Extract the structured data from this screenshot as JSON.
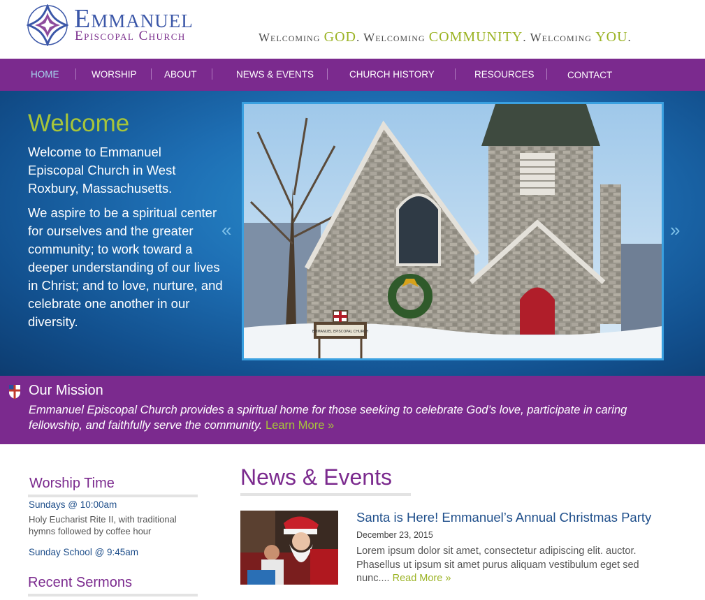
{
  "brand": {
    "name": "Emmanuel",
    "subtitle": "Episcopal Church",
    "tagline": {
      "w1": "Welcoming ",
      "h1": "GOD",
      "p1": ". ",
      "w2": "Welcoming ",
      "h2": "COMMUNITY",
      "p2": ". ",
      "w3": "Welcoming ",
      "h3": "YOU",
      "p3": "."
    }
  },
  "nav": {
    "items": [
      {
        "label": "Home"
      },
      {
        "label": "Worship"
      },
      {
        "label": "About"
      },
      {
        "label": "News & Events"
      },
      {
        "label": "Church History"
      },
      {
        "label": "Resources"
      },
      {
        "label": "Contact"
      }
    ],
    "active": "Home"
  },
  "hero": {
    "title": "Welcome",
    "paragraph1": "Welcome to Emmanuel Episcopal Church in West Roxbury, Massachusetts.",
    "paragraph2": "We aspire to be a spiritual center for ourselves and the greater community; to work toward a deeper understanding of our lives in Christ; and to love, nurture, and celebrate one another in our diversity.",
    "prev_glyph": "«",
    "next_glyph": "»",
    "sign_text": "EMMANUEL EPISCOPAL CHURCH"
  },
  "mission": {
    "title": "Our Mission",
    "text": "Emmanuel Episcopal Church provides a spiritual home for those seeking to celebrate God’s love, participate in caring fellowship, and faithfully serve the community. ",
    "link": "Learn More »"
  },
  "sidebar": {
    "worship_title": "Worship Time",
    "service1_time": "Sundays @ 10:00am",
    "service1_desc": "Holy Eucharist Rite II, with traditional hymns followed by coffee hour",
    "service2_time": "Sunday School @ 9:45am",
    "sermons_title": "Recent Sermons"
  },
  "news": {
    "title": "News & Events",
    "items": [
      {
        "headline": "Santa is Here! Emmanuel’s Annual Christmas Party",
        "date": "December 23, 2015",
        "excerpt": "Lorem ipsum dolor sit amet, consectetur adipiscing elit. auctor. Phasellus ut ipsum sit amet purus aliquam vestibulum eget sed nunc.... ",
        "more": "Read More »"
      }
    ]
  },
  "colors": {
    "purple": "#7b2a8e",
    "green": "#a7c53a",
    "blue": "#1f4f8b",
    "logo_blue": "#3b57a8"
  }
}
